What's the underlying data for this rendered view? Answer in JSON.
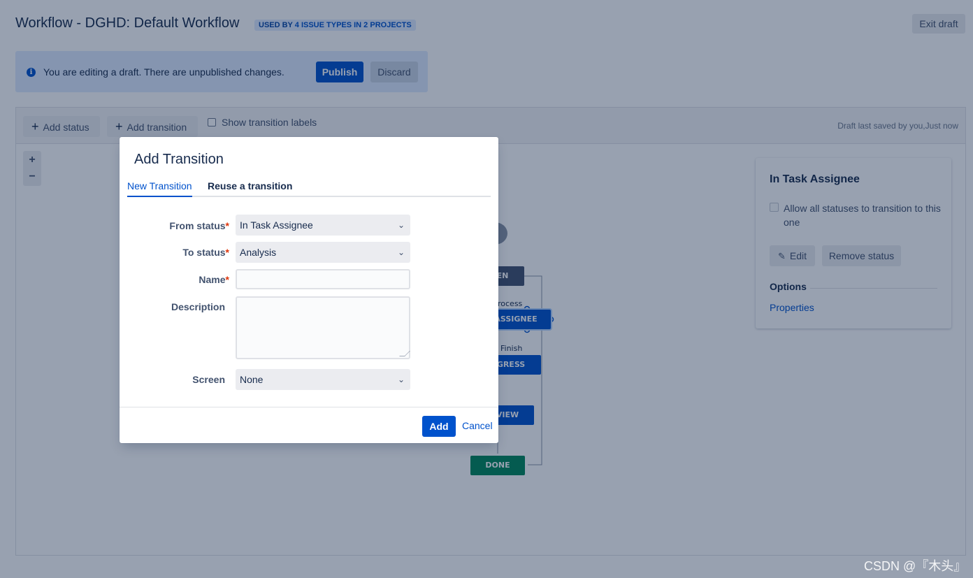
{
  "header": {
    "title": "Workflow - DGHD: Default Workflow",
    "usage_prefix": "USED BY",
    "usage_link": "4 ISSUE TYPES IN 2 PROJECTS",
    "exit_draft_label": "Exit draft"
  },
  "banner": {
    "icon": "info-icon",
    "message": "You are editing a draft. There are unpublished changes.",
    "publish_label": "Publish",
    "discard_label": "Discard"
  },
  "toolbar": {
    "add_status_label": "Add status",
    "add_transition_label": "Add transition",
    "show_labels_label": "Show transition labels",
    "saved_text": "Draft last saved by you,Just now"
  },
  "zoom": {
    "in_label": "+",
    "out_label": "−"
  },
  "diagram": {
    "nodes": [
      "EN",
      "ASSIGNEE",
      "GRESS",
      "VIEW",
      "DONE"
    ],
    "labels": [
      "rocess",
      "Finish"
    ]
  },
  "side_panel": {
    "title": "In Task Assignee",
    "allow_all_label": "Allow all statuses to transition to this one",
    "edit_label": "Edit",
    "remove_label": "Remove status",
    "options_heading": "Options",
    "properties_link": "Properties"
  },
  "dialog": {
    "title": "Add Transition",
    "tabs": [
      {
        "label": "New Transition",
        "active": true
      },
      {
        "label": "Reuse a transition",
        "active": false
      }
    ],
    "fields": {
      "from_status": {
        "label": "From status",
        "value": "In Task Assignee",
        "required": true
      },
      "to_status": {
        "label": "To status",
        "value": "Analysis",
        "required": true
      },
      "name": {
        "label": "Name",
        "value": "",
        "required": true
      },
      "description": {
        "label": "Description",
        "value": ""
      },
      "screen": {
        "label": "Screen",
        "value": "None"
      }
    },
    "add_label": "Add",
    "cancel_label": "Cancel"
  },
  "watermark": "CSDN @『木头』",
  "colors": {
    "primary": "#0052cc",
    "banner_bg": "#deebff",
    "done_green": "#00875a",
    "open_gray": "#42526e",
    "required": "#de350b"
  }
}
